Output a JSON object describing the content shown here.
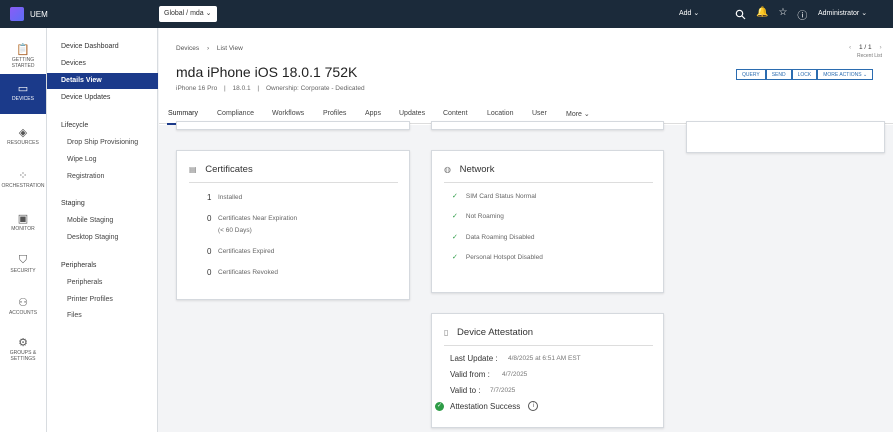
{
  "topbar": {
    "app_name": "UEM",
    "org_selector": "Global / mda",
    "add_label": "Add",
    "admin_label": "Administrator"
  },
  "leftnav": [
    {
      "label": "GETTING STARTED",
      "icon": "clipboard-icon"
    },
    {
      "label": "DEVICES",
      "icon": "devices-icon"
    },
    {
      "label": "RESOURCES",
      "icon": "resources-icon"
    },
    {
      "label": "ORCHESTRATION",
      "icon": "orchestration-icon"
    },
    {
      "label": "MONITOR",
      "icon": "monitor-icon"
    },
    {
      "label": "SECURITY",
      "icon": "shield-icon"
    },
    {
      "label": "ACCOUNTS",
      "icon": "accounts-icon"
    },
    {
      "label": "GROUPS & SETTINGS",
      "icon": "gear-icon"
    }
  ],
  "subnav": {
    "links": [
      "Device Dashboard",
      "Devices",
      "Details View",
      "Device Updates"
    ],
    "lifecycle": {
      "heading": "Lifecycle",
      "items": [
        "Drop Ship Provisioning",
        "Wipe Log",
        "Registration"
      ]
    },
    "staging": {
      "heading": "Staging",
      "items": [
        "Mobile Staging",
        "Desktop Staging"
      ]
    },
    "peripherals": {
      "heading": "Peripherals",
      "items": [
        "Peripherals",
        "Printer Profiles",
        "Files"
      ]
    }
  },
  "header": {
    "breadcrumb_root": "Devices",
    "breadcrumb_current": "List View",
    "pager": "1 / 1",
    "recent": "Recent List",
    "title": "mda iPhone iOS 18.0.1 752K",
    "model": "iPhone 16 Pro",
    "os": "18.0.1",
    "ownership": "Ownership: Corporate - Dedicated",
    "actions": [
      "QUERY",
      "SEND",
      "LOCK",
      "MORE ACTIONS"
    ]
  },
  "tabs": [
    "Summary",
    "Compliance",
    "Workflows",
    "Profiles",
    "Apps",
    "Updates",
    "Content",
    "Location",
    "User",
    "More"
  ],
  "certificates": {
    "title": "Certificates",
    "rows": [
      {
        "count": "1",
        "label": "Installed"
      },
      {
        "count": "0",
        "label": "Certificates Near Expiration",
        "label2": "(< 60 Days)"
      },
      {
        "count": "0",
        "label": "Certificates Expired"
      },
      {
        "count": "0",
        "label": "Certificates Revoked"
      }
    ]
  },
  "network": {
    "title": "Network",
    "rows": [
      "SIM Card Status Normal",
      "Not Roaming",
      "Data Roaming Disabled",
      "Personal Hotspot Disabled"
    ]
  },
  "attestation": {
    "title": "Device Attestation",
    "last_update_label": "Last Update :",
    "last_update_value": "4/8/2025 at 6:51 AM EST",
    "valid_from_label": "Valid from :",
    "valid_from_value": "4/7/2025",
    "valid_to_label": "Valid to :",
    "valid_to_value": "7/7/2025",
    "status": "Attestation Success"
  }
}
